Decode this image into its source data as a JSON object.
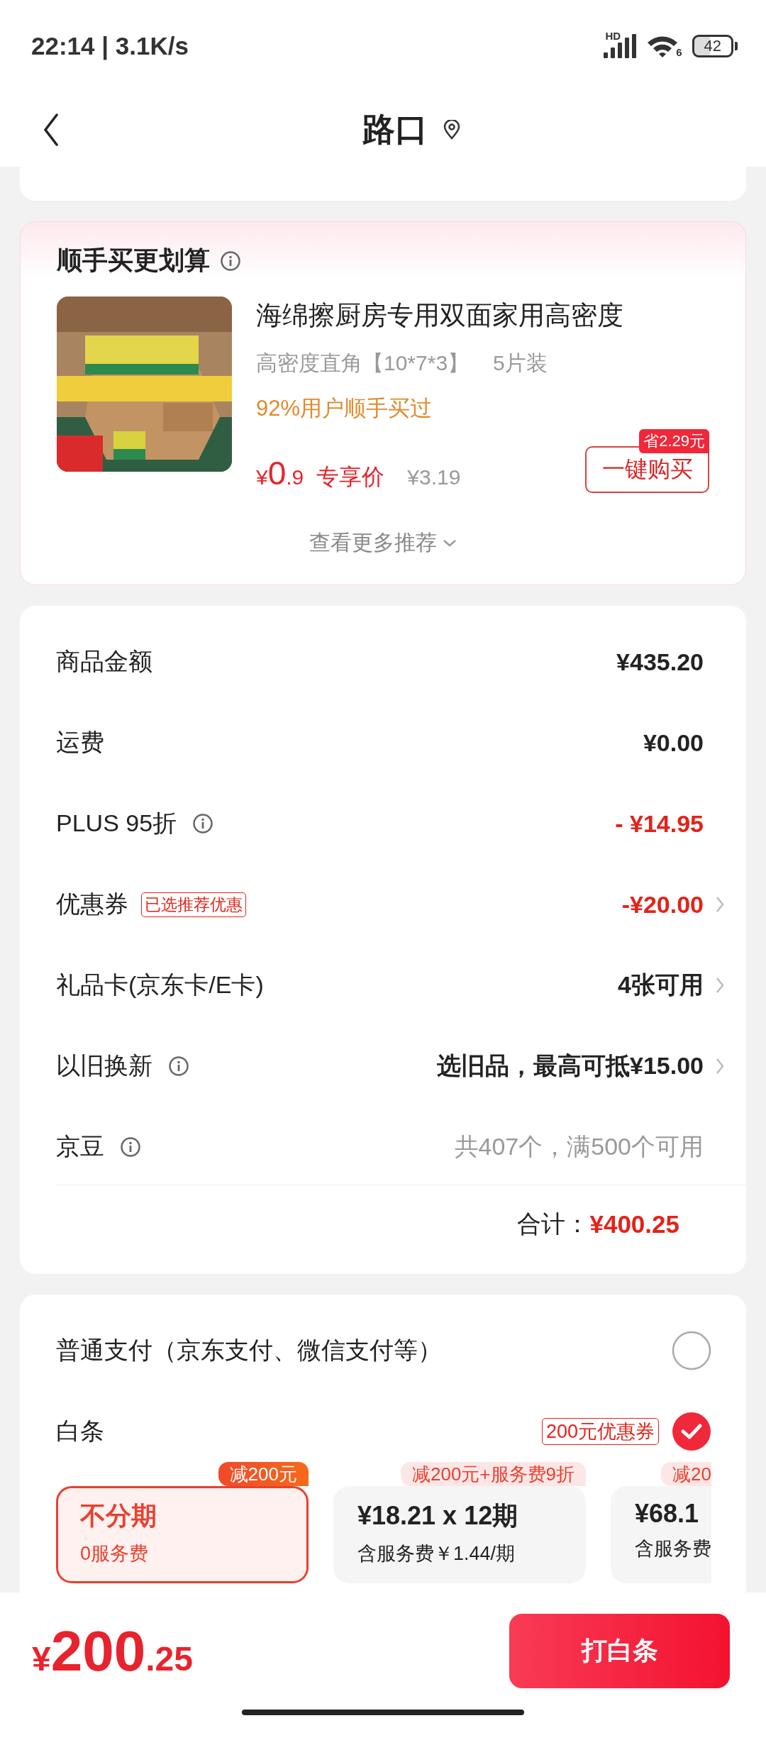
{
  "status_bar": {
    "time": "22:14 | 3.1K/s",
    "network_label": "HD",
    "wifi_label": "6",
    "battery": "42"
  },
  "nav": {
    "title": "路口"
  },
  "upsell": {
    "title": "顺手买更划算",
    "product": {
      "name": "海绵擦厨房专用双面家用高密度",
      "variant": "高密度直角【10*7*3】",
      "pack": "5片装",
      "social_proof": "92%用户顺手买过",
      "currency": "¥",
      "price_int": "0",
      "price_dec": ".9",
      "price_label": "专享价",
      "original_price": "¥3.19",
      "save_badge": "省2.29元",
      "buy_button": "一键购买"
    },
    "more_link": "查看更多推荐"
  },
  "summary": {
    "rows": [
      {
        "label": "商品金额",
        "info": false,
        "value": "¥435.20",
        "kind": "normal",
        "chevron": false
      },
      {
        "label": "运费",
        "info": false,
        "value": "¥0.00",
        "kind": "normal",
        "chevron": false
      },
      {
        "label": "PLUS 95折",
        "info": true,
        "value": "- ¥14.95",
        "kind": "discount",
        "chevron": false
      },
      {
        "label": "优惠券",
        "info": false,
        "tag": "已选推荐优惠",
        "value": "-¥20.00",
        "kind": "discount",
        "chevron": true
      },
      {
        "label": "礼品卡(京东卡/E卡)",
        "info": false,
        "value": "4张可用",
        "kind": "normal",
        "chevron": true
      },
      {
        "label": "以旧换新",
        "info": true,
        "value": "选旧品，最高可抵¥15.00",
        "kind": "normal",
        "chevron": true
      },
      {
        "label": "京豆",
        "info": true,
        "value": "共407个，满500个可用",
        "kind": "muted",
        "chevron": false
      }
    ],
    "total_label": "合计：",
    "total_value": "¥400.25"
  },
  "payment": {
    "options": [
      {
        "label": "普通支付（京东支付、微信支付等）",
        "selected": false
      },
      {
        "label": "白条",
        "badge": "200元优惠券",
        "selected": true
      }
    ],
    "plans": [
      {
        "tag": "减200元",
        "title": "不分期",
        "subtitle": "0服务费",
        "selected": true
      },
      {
        "tag": "减200元+服务费9折",
        "title": "¥18.21 x 12期",
        "subtitle": "含服务费￥1.44/期",
        "selected": false
      },
      {
        "tag": "减20",
        "title": "¥68.1",
        "subtitle": "含服务费",
        "selected": false
      }
    ]
  },
  "bottom_bar": {
    "currency": "¥",
    "price_int": "200",
    "price_dec": ".25",
    "pay_button": "打白条"
  }
}
